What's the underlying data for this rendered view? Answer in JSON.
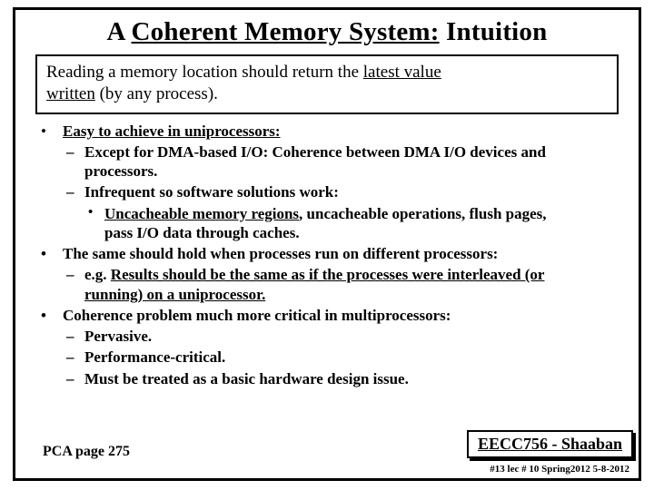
{
  "title": {
    "pre": "A ",
    "underlined": "Coherent Memory System:",
    "post": "  Intuition"
  },
  "intro": {
    "t1": "Reading a memory location should return the ",
    "t2": "latest value",
    "t3": "written",
    "t4": " (by any process)."
  },
  "b1": {
    "head": "Easy to achieve in uniprocessors:",
    "s1a": "Except for DMA-based I/O:  Coherence between DMA I/O devices and",
    "s1b": "processors.",
    "s2": "Infrequent so software solutions work:",
    "s2a_u1": "Uncacheable memory regions",
    "s2a_mid": ", uncacheable operations, flush pages,",
    "s2a_line2": "pass I/O data through caches."
  },
  "b2": {
    "head": "The same should hold when processes run on different processors:",
    "s1a": "e.g. ",
    "s1b": "Results should be the same as if the processes were interleaved (or",
    "s1c": "running) on a uniprocessor."
  },
  "b3": {
    "head": "Coherence problem much more critical in multiprocessors:",
    "s1": "Pervasive.",
    "s2": "Performance-critical.",
    "s3": "Must be treated as a basic hardware design issue."
  },
  "footer": {
    "left": "PCA page 275",
    "right": "EECC756 - Shaaban",
    "meta": "#13   lec # 10   Spring2012  5-8-2012"
  }
}
